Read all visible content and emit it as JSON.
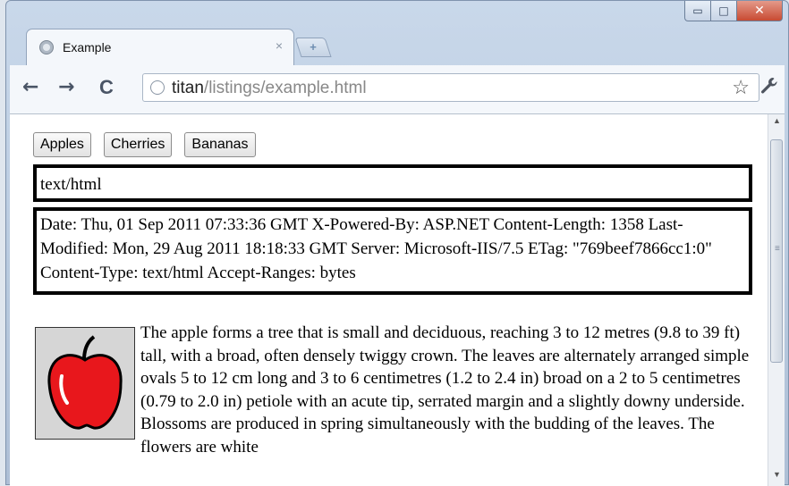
{
  "window": {
    "controls": {
      "minimize": "▭",
      "maximize": "□",
      "close": "✕"
    }
  },
  "tab": {
    "title": "Example",
    "close": "×",
    "new_tab": "+"
  },
  "toolbar": {
    "back": "←",
    "forward": "→",
    "reload": "C",
    "url_host": "titan",
    "url_path": "/listings/example.html",
    "star": "☆",
    "wrench": "🔧"
  },
  "page": {
    "buttons": [
      "Apples",
      "Cherries",
      "Bananas"
    ],
    "content_type": "text/html",
    "headers": "Date: Thu, 01 Sep 2011 07:33:36 GMT X-Powered-By: ASP.NET Content-Length: 1358 Last-Modified: Mon, 29 Aug 2011 18:18:33 GMT Server: Microsoft-IIS/7.5 ETag: \"769beef7866cc1:0\" Content-Type: text/html Accept-Ranges: bytes",
    "paragraph": "The apple forms a tree that is small and deciduous, reaching 3 to 12 metres (9.8 to 39 ft) tall, with a broad, often densely twiggy crown. The leaves are alternately arranged simple ovals 5 to 12 cm long and 3 to 6 centimetres (1.2 to 2.4 in) broad on a 2 to 5 centimetres (0.79 to 2.0 in) petiole with an acute tip, serrated margin and a slightly downy underside. Blossoms are produced in spring simultaneously with the budding of the leaves. The flowers are white"
  },
  "colors": {
    "apple_red": "#e8171c",
    "close_red": "#c84a32"
  }
}
